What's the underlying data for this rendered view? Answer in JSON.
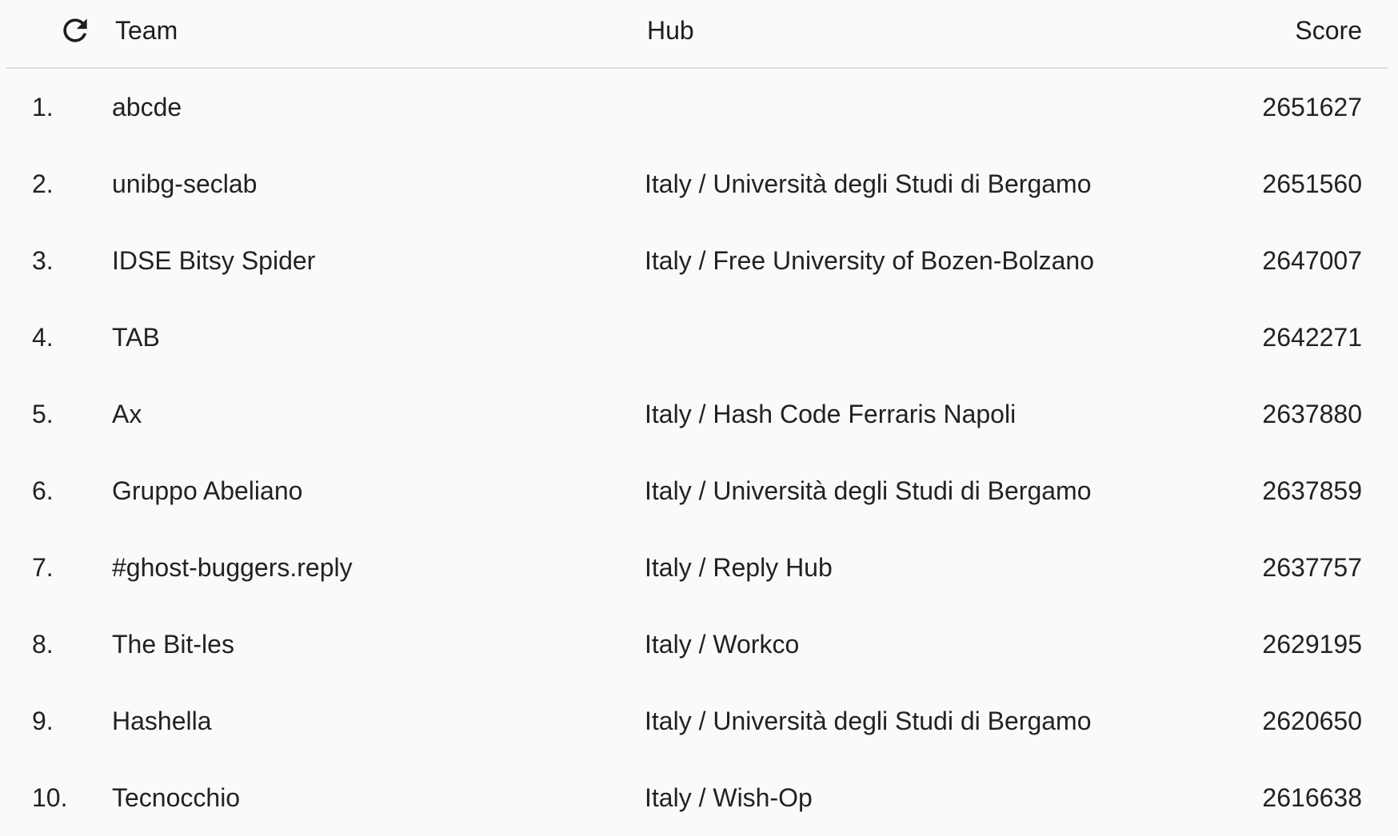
{
  "header": {
    "refresh_icon": "refresh-icon",
    "team_label": "Team",
    "hub_label": "Hub",
    "score_label": "Score"
  },
  "rows": [
    {
      "rank": "1.",
      "team": "abcde",
      "hub": "",
      "score": "2651627"
    },
    {
      "rank": "2.",
      "team": "unibg-seclab",
      "hub": "Italy / Università degli Studi di Bergamo",
      "score": "2651560"
    },
    {
      "rank": "3.",
      "team": "IDSE Bitsy Spider",
      "hub": "Italy / Free University of Bozen-Bolzano",
      "score": "2647007"
    },
    {
      "rank": "4.",
      "team": "TAB",
      "hub": "",
      "score": "2642271"
    },
    {
      "rank": "5.",
      "team": "Ax",
      "hub": "Italy / Hash Code Ferraris Napoli",
      "score": "2637880"
    },
    {
      "rank": "6.",
      "team": "Gruppo Abeliano",
      "hub": "Italy / Università degli Studi di Bergamo",
      "score": "2637859"
    },
    {
      "rank": "7.",
      "team": "#ghost-buggers.reply",
      "hub": "Italy / Reply Hub",
      "score": "2637757"
    },
    {
      "rank": "8.",
      "team": "The Bit-les",
      "hub": "Italy / Workco",
      "score": "2629195"
    },
    {
      "rank": "9.",
      "team": "Hashella",
      "hub": "Italy / Università degli Studi di Bergamo",
      "score": "2620650"
    },
    {
      "rank": "10.",
      "team": "Tecnocchio",
      "hub": "Italy / Wish-Op",
      "score": "2616638"
    }
  ]
}
